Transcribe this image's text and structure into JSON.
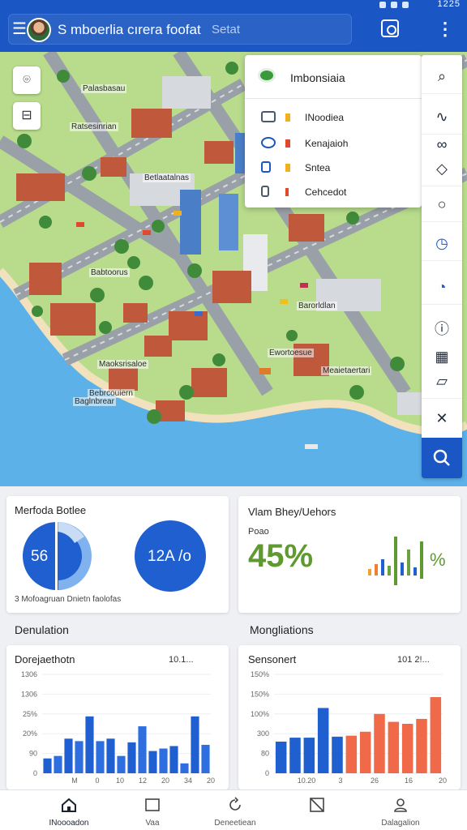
{
  "status": {
    "time": "1225"
  },
  "header": {
    "search_text": "S mboerlia cırera foofat",
    "search_placeholder": "Setat"
  },
  "map": {
    "labels": [
      "Palasbasau",
      "Ratsesinrian",
      "Betlaatalnas",
      "Babtoorus",
      "Barorldlan",
      "Ewortoesue",
      "Meaietaertari",
      "Maoksrisaloe",
      "Bebrcouiern",
      "Baglnbrear"
    ]
  },
  "dropdown": {
    "title": "Imbonsiaia",
    "items": [
      {
        "label": "INoodiea",
        "icon": "layers-icon"
      },
      {
        "label": "Kenajaioh",
        "icon": "eye-icon"
      },
      {
        "label": "Sntea",
        "icon": "pin-icon"
      },
      {
        "label": "Cehcedot",
        "icon": "lock-icon"
      }
    ]
  },
  "cards": {
    "donut_card": {
      "title": "Merfoda Botlee",
      "values": [
        "56",
        "12A /o"
      ],
      "footnote": "3 Mofoagruan Dnietn faolofas"
    },
    "percent_card": {
      "title": "Vlam Bhey/Uehors",
      "sub_label": "Poao",
      "percent": "45%",
      "chart_suffix": "%"
    }
  },
  "sections": {
    "left": "Denulation",
    "right": "Mongliations"
  },
  "charts": {
    "left": {
      "title": "Dorejaethotn",
      "control": "10.1..."
    },
    "right": {
      "title": "Sensonert",
      "control": "101 2!..."
    }
  },
  "chart_data": [
    {
      "type": "bar",
      "title": "Dorejaethotn",
      "yticks": [
        "1306",
        "1306",
        "25%",
        "20%",
        "90",
        "0"
      ],
      "xticks": [
        "M",
        "0",
        "10",
        "12",
        "20",
        "34",
        "20"
      ],
      "values": [
        12,
        14,
        28,
        26,
        46,
        26,
        28,
        14,
        25,
        38,
        18,
        20,
        22,
        8,
        46,
        23
      ],
      "colors": [
        "#1f5fcf",
        "#2d6fe0"
      ],
      "ylim": [
        0,
        80
      ]
    },
    {
      "type": "bar",
      "title": "Sensonert",
      "yticks": [
        "150%",
        "150%",
        "100%",
        "300",
        "80",
        "0"
      ],
      "xticks": [
        "10.20",
        "3",
        "26",
        "16",
        "20"
      ],
      "series": [
        {
          "values": [
            32,
            36,
            36,
            66,
            37
          ]
        },
        {
          "values": [
            38,
            42,
            60,
            52,
            50,
            55,
            77
          ]
        }
      ],
      "colors": [
        "#1f5fcf",
        "#f06a4a"
      ],
      "ylim": [
        0,
        100
      ]
    }
  ],
  "nav": [
    {
      "label": "INoooadon",
      "icon": "home-icon"
    },
    {
      "label": "Vaa",
      "icon": "square-icon"
    },
    {
      "label": "Deneetiean",
      "icon": "refresh-icon"
    },
    {
      "label": "",
      "icon": "crop-icon"
    },
    {
      "label": "Dalagalion",
      "icon": "user-icon"
    }
  ]
}
